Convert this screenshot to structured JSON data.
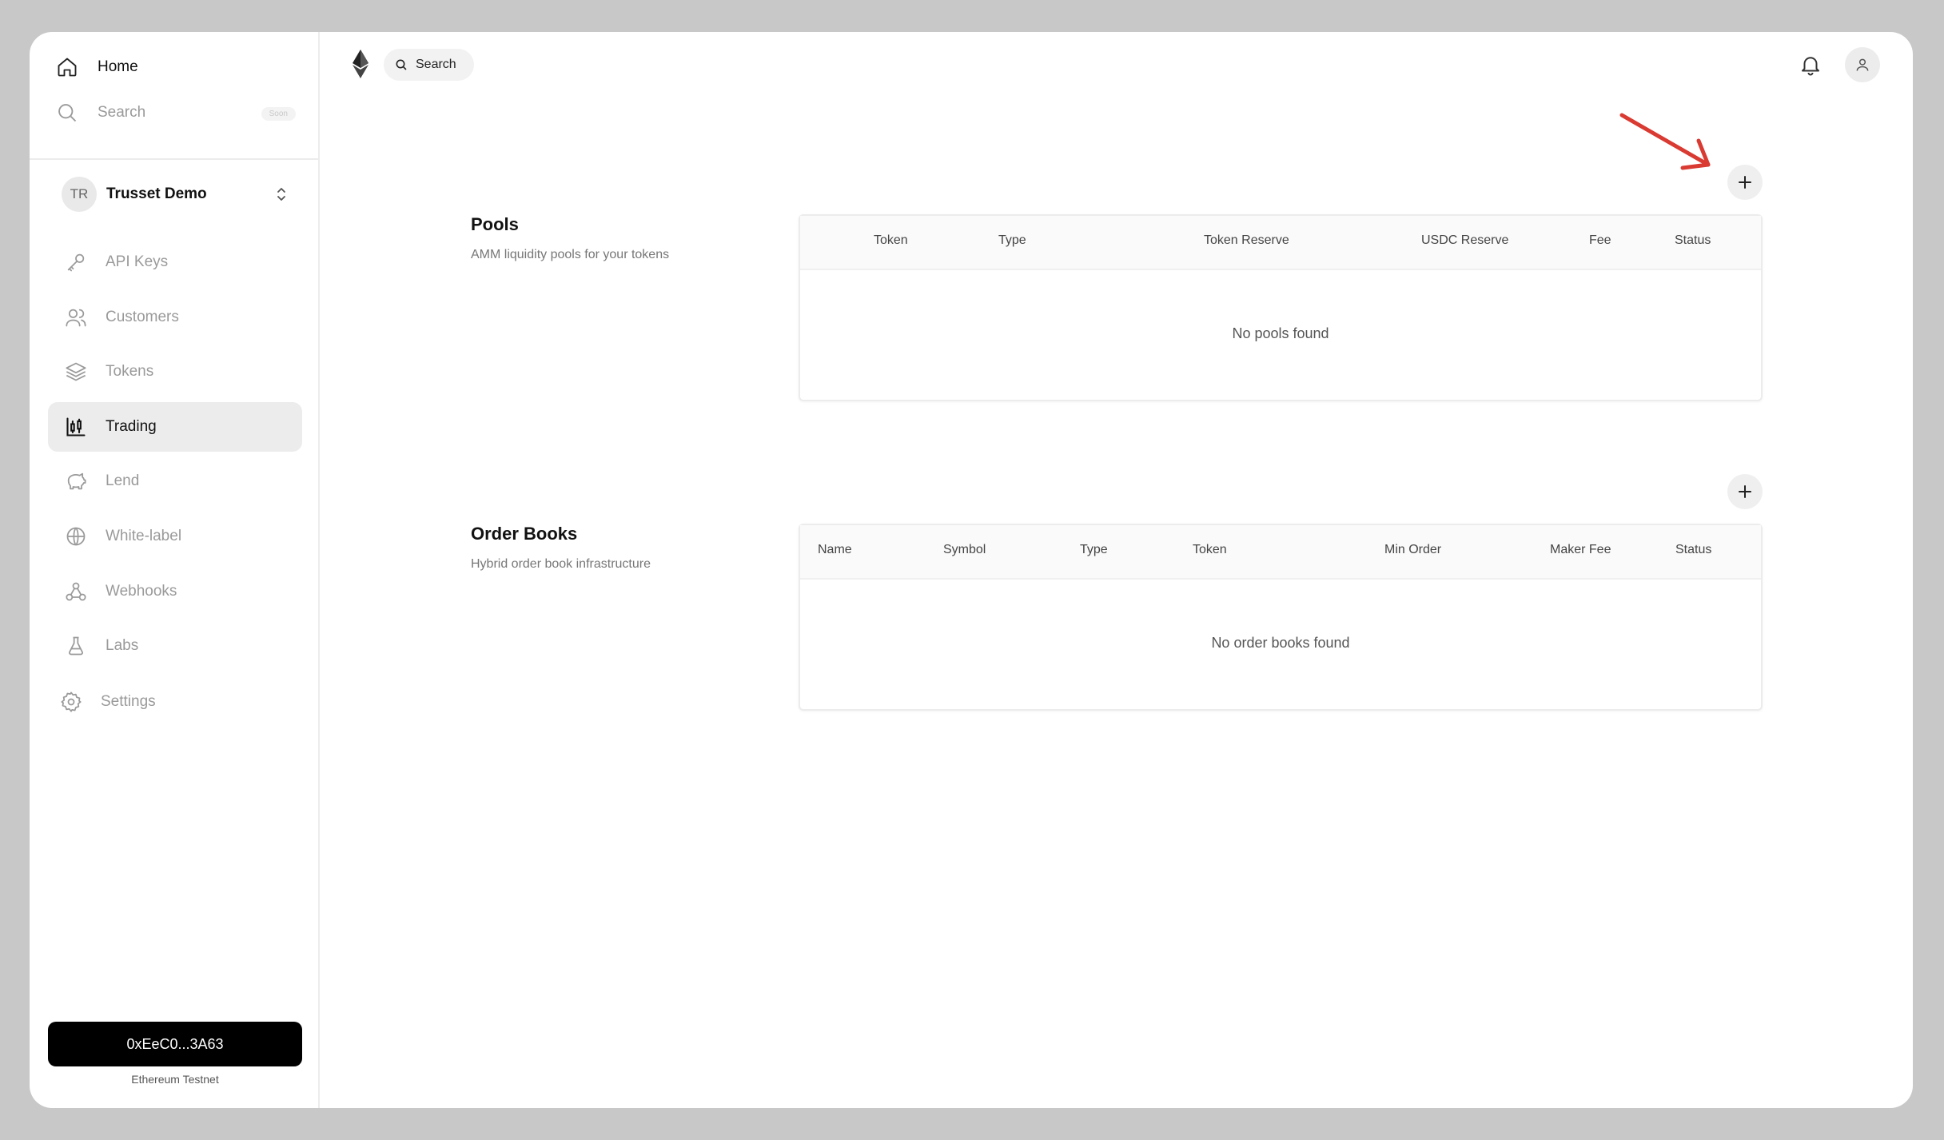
{
  "sidebar": {
    "home_label": "Home",
    "search_label": "Search",
    "search_badge": "Soon",
    "workspace": {
      "initials": "TR",
      "name": "Trusset Demo"
    },
    "nav": [
      {
        "label": "API Keys",
        "icon": "key-icon",
        "active": false
      },
      {
        "label": "Customers",
        "icon": "users-icon",
        "active": false
      },
      {
        "label": "Tokens",
        "icon": "layers-icon",
        "active": false
      },
      {
        "label": "Trading",
        "icon": "chart-icon",
        "active": true
      },
      {
        "label": "Lend",
        "icon": "piggy-bank-icon",
        "active": false
      },
      {
        "label": "White-label",
        "icon": "globe-icon",
        "active": false
      },
      {
        "label": "Webhooks",
        "icon": "webhook-icon",
        "active": false
      },
      {
        "label": "Labs",
        "icon": "flask-icon",
        "active": false
      }
    ],
    "settings_label": "Settings",
    "wallet_address": "0xEeC0...3A63",
    "network": "Ethereum Testnet"
  },
  "topbar": {
    "search_label": "Search"
  },
  "pools": {
    "title": "Pools",
    "description": "AMM liquidity pools for your tokens",
    "columns": [
      "Token",
      "Type",
      "Token Reserve",
      "USDC Reserve",
      "Fee",
      "Status"
    ],
    "empty_text": "No pools found"
  },
  "order_books": {
    "title": "Order Books",
    "description": "Hybrid order book infrastructure",
    "columns": [
      "Name",
      "Symbol",
      "Type",
      "Token",
      "Min Order",
      "Maker Fee",
      "Status"
    ],
    "empty_text": "No order books found"
  },
  "colors": {
    "annotation_arrow": "#d93a32",
    "wallet_button": "#000000",
    "active_nav": "#ececec"
  }
}
